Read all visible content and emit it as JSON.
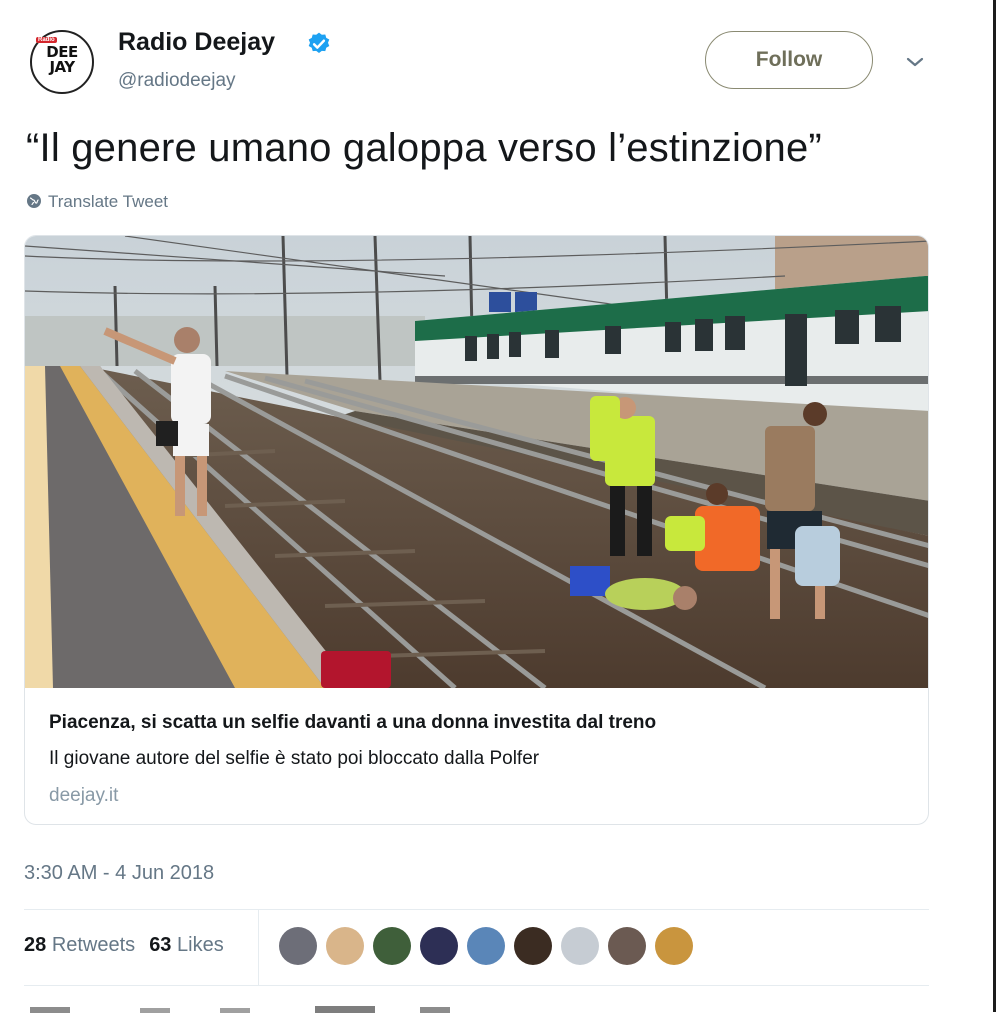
{
  "account": {
    "name": "Radio Deejay",
    "handle": "@radiodeejay",
    "avatar_logo_line1": "DEE",
    "avatar_logo_line2": "JAY",
    "avatar_logo_tag": "Radio",
    "verified": true,
    "verified_color": "#1da1f2"
  },
  "actions": {
    "follow_label": "Follow",
    "more_icon": "chevron-down-icon"
  },
  "tweet": {
    "text": "“Il genere umano galoppa verso l’estinzione”",
    "translate_label": "Translate Tweet",
    "timestamp": "3:30 AM - 4 Jun 2018"
  },
  "card": {
    "image_icon": "railway-photo",
    "title": "Piacenza, si scatta un selfie davanti a una donna investita dal treno",
    "description": "Il giovane autore del selfie è stato poi bloccato dalla Polfer",
    "domain": "deejay.it"
  },
  "stats": {
    "retweets_count": "28",
    "retweets_label": "Retweets",
    "likes_count": "63",
    "likes_label": "Likes"
  },
  "likers": [
    {
      "icon": "liker-avatar-1",
      "color": "#6d6e78"
    },
    {
      "icon": "liker-avatar-2",
      "color": "#d9b58a"
    },
    {
      "icon": "liker-avatar-3",
      "color": "#3f5f3a"
    },
    {
      "icon": "liker-avatar-4",
      "color": "#2d2f55"
    },
    {
      "icon": "liker-avatar-5",
      "color": "#5a86b8"
    },
    {
      "icon": "liker-avatar-6",
      "color": "#3b2c22"
    },
    {
      "icon": "liker-avatar-7",
      "color": "#c6ccd3"
    },
    {
      "icon": "liker-avatar-8",
      "color": "#6b5a52"
    },
    {
      "icon": "liker-avatar-9",
      "color": "#c9953e"
    }
  ]
}
